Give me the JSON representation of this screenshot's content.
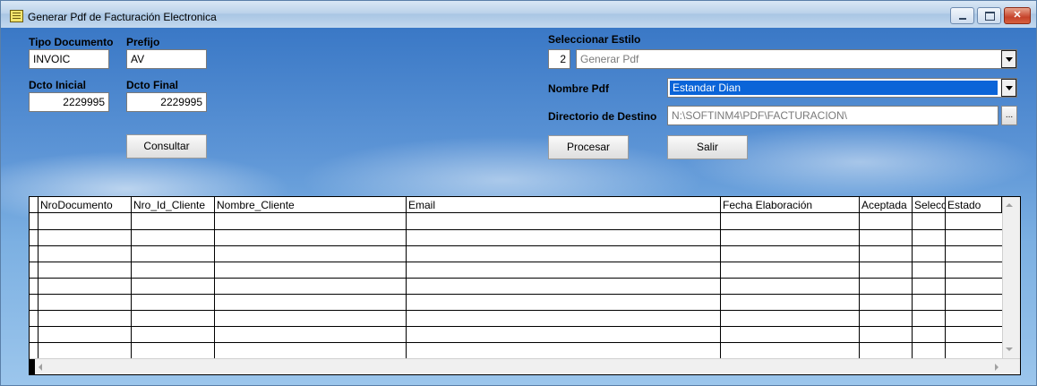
{
  "window": {
    "title": "Generar Pdf de Facturación Electronica"
  },
  "form": {
    "tipo_documento": {
      "label": "Tipo Documento",
      "value": "INVOIC"
    },
    "prefijo": {
      "label": "Prefijo",
      "value": "AV"
    },
    "dcto_inicial": {
      "label": "Dcto Inicial",
      "value": "2229995"
    },
    "dcto_final": {
      "label": "Dcto Final",
      "value": "2229995"
    },
    "consultar_button": "Consultar",
    "seleccionar_estilo": {
      "label": "Seleccionar Estilo",
      "code": "2",
      "value": "Generar Pdf"
    },
    "nombre_pdf": {
      "label": "Nombre Pdf",
      "value": "Estandar Dian"
    },
    "directorio_destino": {
      "label": "Directorio de Destino",
      "value": "N:\\SOFTINM4\\PDF\\FACTURACION\\",
      "browse_label": "..."
    },
    "procesar_button": "Procesar",
    "salir_button": "Salir"
  },
  "grid": {
    "columns": [
      "NroDocumento",
      "Nro_Id_Cliente",
      "Nombre_Cliente",
      "Email",
      "Fecha Elaboración",
      "Aceptada",
      "Selecc",
      "Estado"
    ],
    "rows": []
  },
  "colors": {
    "selected_combo": "#0a64d8",
    "background_sky": "#5d95d6"
  }
}
